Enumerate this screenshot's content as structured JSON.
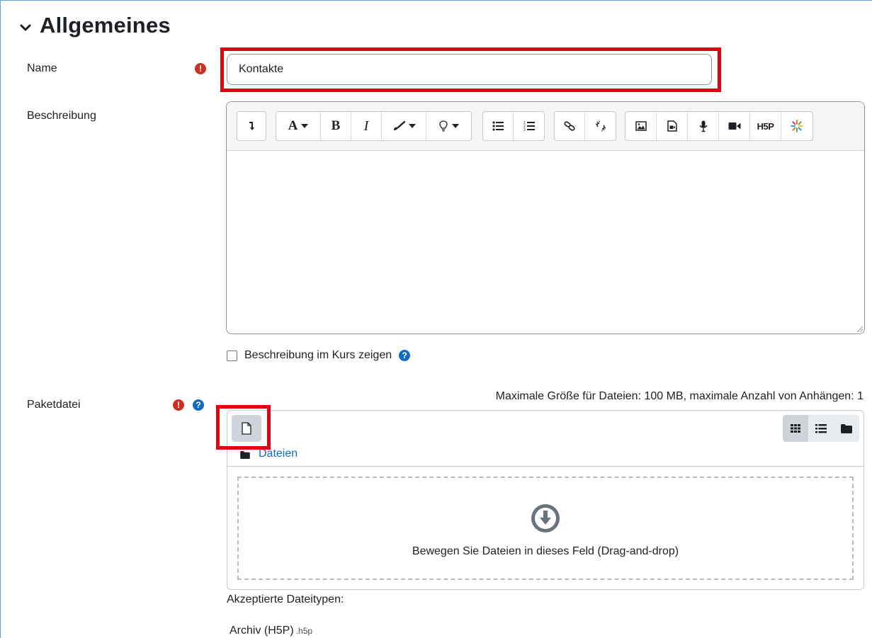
{
  "section": {
    "title": "Allgemeines"
  },
  "name_field": {
    "label": "Name",
    "value": "Kontakte"
  },
  "description_field": {
    "label": "Beschreibung",
    "toolbar": {
      "show_more": "show-more-icon",
      "font": "A",
      "bold": "B",
      "italic": "I",
      "h5p": "H5P"
    }
  },
  "show_in_course": {
    "label": "Beschreibung im Kurs zeigen",
    "checked": false
  },
  "package_file": {
    "label": "Paketdatei",
    "max_size_text": "Maximale Größe für Dateien: 100 MB, maximale Anzahl von Anhängen: 1",
    "path_label": "Dateien",
    "drop_text": "Bewegen Sie Dateien in dieses Feld (Drag-and-drop)",
    "view_mode": "icons"
  },
  "accepted_types": {
    "label": "Akzeptierte Dateitypen:",
    "items": [
      {
        "name": "Archiv (H5P)",
        "ext": ".h5p"
      }
    ]
  },
  "colors": {
    "required": "#ca3120",
    "help": "#0f6cbf",
    "highlight": "#e3000f",
    "link": "#0f6cbf"
  }
}
